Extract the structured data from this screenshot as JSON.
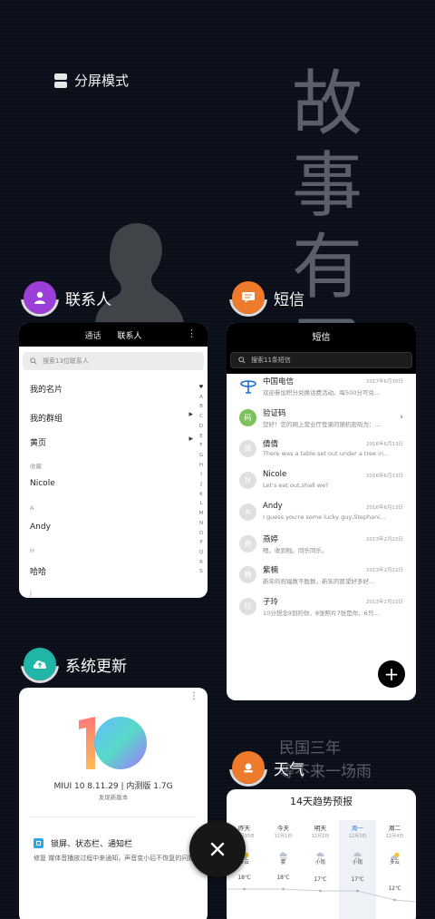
{
  "split_screen": {
    "label": "分屏模式",
    "icon": "split-screen-icon"
  },
  "wallpaper": {
    "big_text": [
      "故",
      "事",
      "有",
      "了"
    ],
    "sub_text": [
      "民国三年",
      "等不来一场雨"
    ]
  },
  "contacts": {
    "app_name": "联系人",
    "icon_color": "#9b3fd8",
    "tabs": [
      "通话",
      "联系人"
    ],
    "search_placeholder": "搜索13位联系人",
    "my_card": "我的名片",
    "my_groups": "我的群组",
    "yellow_pages": "黄页",
    "section_favorites": "收藏",
    "favorite": "Nicole",
    "section_a": "A",
    "contact_a": "Andy",
    "section_h": "H",
    "contact_h": "哈哈",
    "section_j": "J",
    "alphabet": [
      "♥",
      "A",
      "B",
      "C",
      "D",
      "E",
      "F",
      "G",
      "H",
      "I",
      "J",
      "K",
      "L",
      "M",
      "N",
      "O",
      "P",
      "Q",
      "R",
      "S"
    ]
  },
  "sms": {
    "app_name": "短信",
    "icon_color": "#ee7a2b",
    "title": "短信",
    "search_placeholder": "搜索11条短信",
    "messages": [
      {
        "name": "中国电信",
        "date": "2017年6月30日",
        "text": "欢迎参加积分兑换话费活动。每500分可兑...",
        "avatar": "",
        "avatar_color": "#ffffff",
        "chevron": ""
      },
      {
        "name": "验证码",
        "date": "",
        "text": "您好！您的网上营业厅登录的随机密码为：...",
        "avatar": "码",
        "avatar_color": "#7dc15a",
        "chevron": "›"
      },
      {
        "name": "倩倩",
        "date": "2016年6月13日",
        "text": "There was a table set out under a tree in...",
        "avatar": "倩",
        "avatar_color": "#dfe0e2",
        "chevron": ""
      },
      {
        "name": "Nicole",
        "date": "2016年6月13日",
        "text": "Let's eat out,shall we?",
        "avatar": "N",
        "avatar_color": "#dfe0e2",
        "chevron": ""
      },
      {
        "name": "Andy",
        "date": "2016年6月13日",
        "text": "I guess you're some lucky guy,Stephani...",
        "avatar": "A",
        "avatar_color": "#dfe0e2",
        "chevron": ""
      },
      {
        "name": "燕婷",
        "date": "2013年2月22日",
        "text": "嗯。收到啦。同乐同乐。",
        "avatar": "燕",
        "avatar_color": "#dfe0e2",
        "chevron": ""
      },
      {
        "name": "紫楠",
        "date": "2013年2月22日",
        "text": "新年的祝福数不胜数，新年的愿望好多好...",
        "avatar": "楠",
        "avatar_color": "#dfe0e2",
        "chevron": ""
      },
      {
        "name": "子玲",
        "date": "2013年2月22日",
        "text": "10分想念9到的你，8张照片7张是你，6只...",
        "avatar": "玲",
        "avatar_color": "#dfe0e2",
        "chevron": ""
      }
    ],
    "fab": "+"
  },
  "update": {
    "app_name": "系统更新",
    "icon_color": "#1fb5a7",
    "version": "MIUI 10 8.11.29 | 内测版 1.7G",
    "new_version": "发现新版本",
    "feature_title": "锁屏、状态栏、通知栏",
    "feature_desc": "修复 媒体音播放过程中来通知，声音变小后不恢复的问题"
  },
  "weather": {
    "app_name": "天气",
    "icon_color": "#ee7a2b",
    "title": "14天趋势预报",
    "days": [
      {
        "day": "昨天",
        "date": "11月30日",
        "cond": "多云",
        "temp": "18℃",
        "icon": "partly-cloudy-icon"
      },
      {
        "day": "今天",
        "date": "12月1日",
        "cond": "雾",
        "temp": "18℃",
        "icon": "fog-icon"
      },
      {
        "day": "明天",
        "date": "12月2日",
        "cond": "小雨",
        "temp": "17℃",
        "icon": "rain-icon"
      },
      {
        "day": "周一",
        "date": "12月3日",
        "cond": "小雨",
        "temp": "17℃",
        "icon": "rain-icon"
      },
      {
        "day": "周二",
        "date": "12月4日",
        "cond": "多云",
        "temp": "12℃",
        "icon": "partly-cloudy-icon"
      }
    ]
  },
  "close_button": {
    "icon": "close-icon"
  }
}
